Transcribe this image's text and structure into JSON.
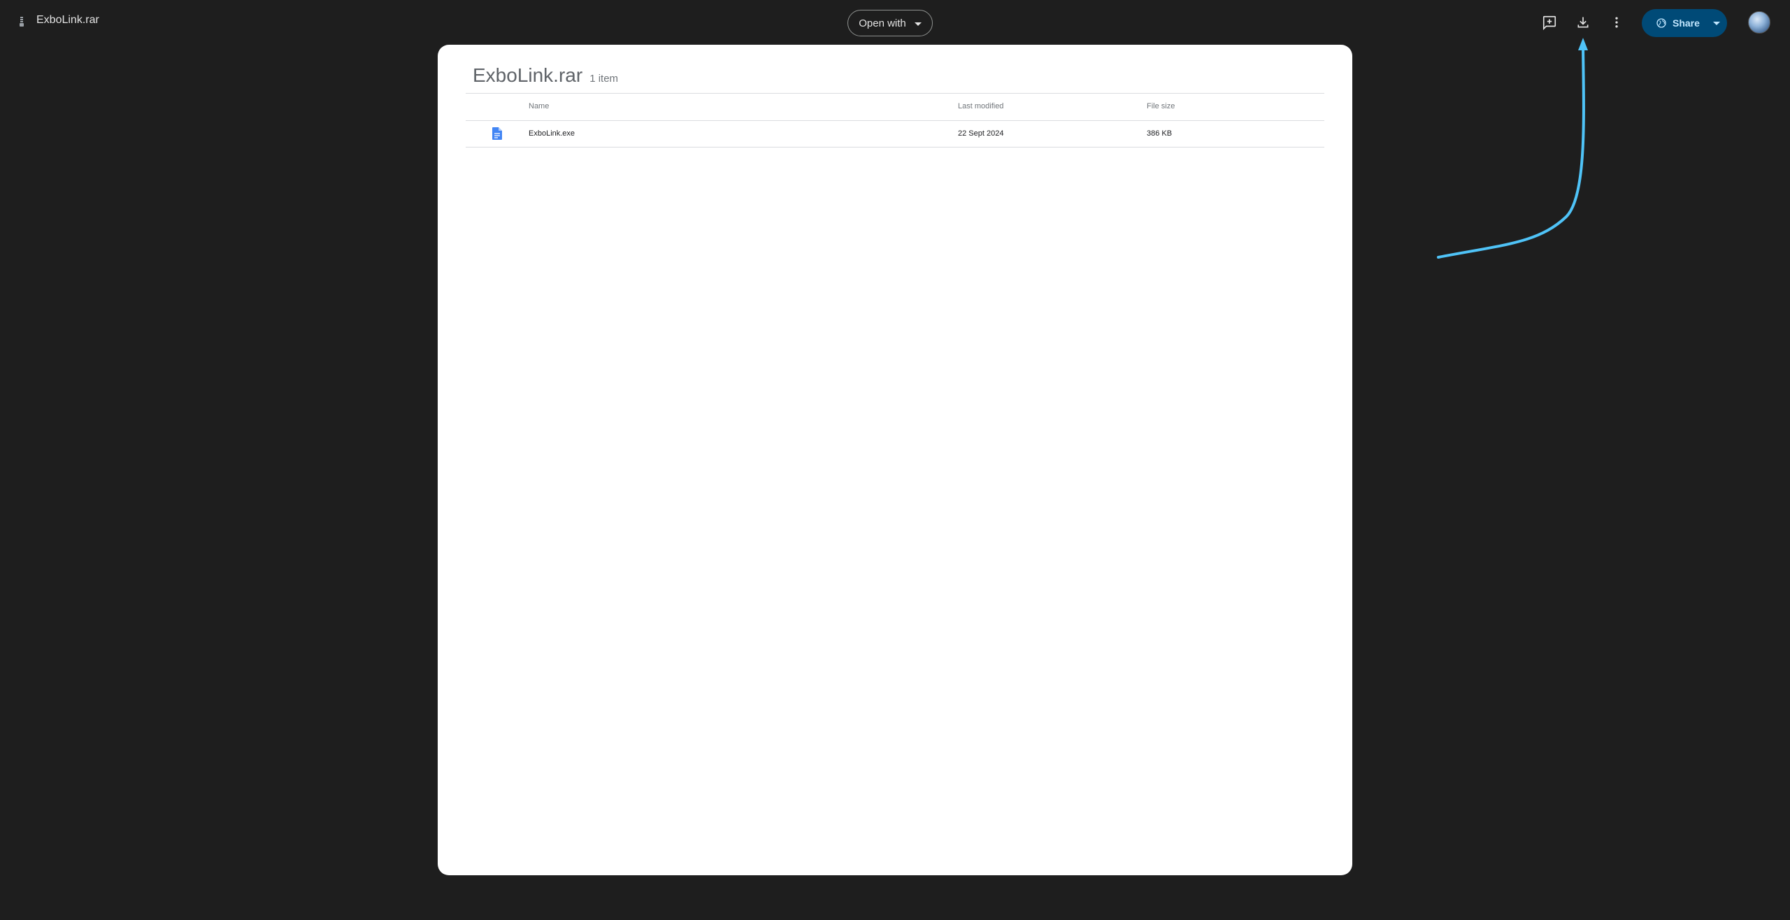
{
  "topbar": {
    "file_title": "ExboLink.rar",
    "open_with_label": "Open with",
    "share_label": "Share",
    "icons": [
      "archive-icon",
      "add-comment-icon",
      "download-icon",
      "more-vert-icon",
      "globe-icon",
      "chevron-down-icon"
    ]
  },
  "archive": {
    "name": "ExboLink.rar",
    "item_count": "1 item",
    "columns": {
      "name": "Name",
      "modified": "Last modified",
      "size": "File size"
    },
    "rows": [
      {
        "icon": "document-icon",
        "name": "ExboLink.exe",
        "modified": "22 Sept 2024",
        "size": "386 KB"
      }
    ]
  },
  "colors": {
    "background": "#1e1e1e",
    "panel": "#ffffff",
    "share_button": "#004a77",
    "annotation_arrow": "#4fc3f7",
    "file_icon": "#4285f4"
  }
}
